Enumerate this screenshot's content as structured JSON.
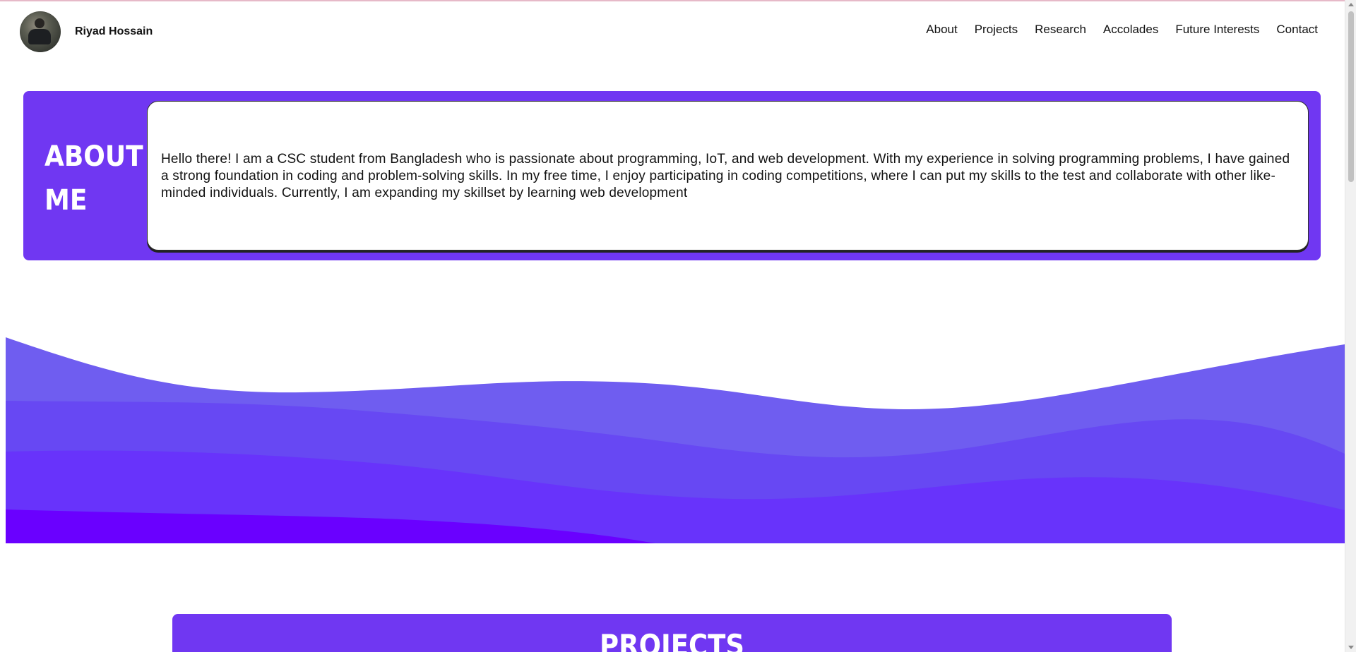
{
  "header": {
    "name": "Riyad Hossain",
    "avatar_label": "profile avatar",
    "nav": [
      "About",
      "Projects",
      "Research",
      "Accolades",
      "Future Interests",
      "Contact"
    ]
  },
  "about": {
    "title_line1": "ABOUT",
    "title_line2": "ME",
    "text": "Hello there! I am a CSC student from Bangladesh who is passionate about programming, IoT, and web development. With my experience in solving programming problems, I have gained a strong foundation in coding and problem-solving skills. In my free time, I enjoy participating in coding competitions, where I can put my skills to the test and collaborate with other like-minded individuals. Currently, I am expanding my skillset by learning web development"
  },
  "projects": {
    "title": "PROJECTS"
  },
  "colors": {
    "accent": "#7037f2",
    "wave1": "#6f5df0",
    "wave2": "#6748f3",
    "wave3": "#6833fb",
    "wave4": "#6a00ff"
  }
}
